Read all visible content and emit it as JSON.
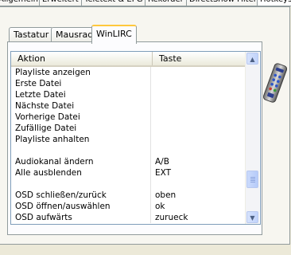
{
  "top_tabs": [
    "Allgemein",
    "Erweitert",
    "Teletext & EPG",
    "Rekorder",
    "DirectShow Filter",
    "Hotkeys"
  ],
  "tabs": [
    {
      "label": "Tastatur"
    },
    {
      "label": "Mausrad"
    },
    {
      "label": "WinLIRC"
    }
  ],
  "active_tab": "WinLIRC",
  "table": {
    "columns": [
      "Aktion",
      "Taste"
    ],
    "rows": [
      {
        "action": "Playliste anzeigen",
        "key": ""
      },
      {
        "action": "Erste Datei",
        "key": ""
      },
      {
        "action": "Letzte Datei",
        "key": ""
      },
      {
        "action": "Nächste Datei",
        "key": ""
      },
      {
        "action": "Vorherige Datei",
        "key": ""
      },
      {
        "action": "Zufällige Datei",
        "key": ""
      },
      {
        "action": "Playliste anhalten",
        "key": ""
      },
      {
        "action": "",
        "key": ""
      },
      {
        "action": "Audiokanal ändern",
        "key": "A/B"
      },
      {
        "action": "Alle ausblenden",
        "key": "EXT"
      },
      {
        "action": "",
        "key": ""
      },
      {
        "action": "OSD schließen/zurück",
        "key": "oben"
      },
      {
        "action": "OSD öffnen/auswählen",
        "key": "ok"
      },
      {
        "action": "OSD aufwärts",
        "key": "zurueck"
      }
    ]
  },
  "scrollbar": {
    "position_fraction": 0.88
  },
  "icons": {
    "remote": "remote-control-icon",
    "scroll_up": "arrow-up-icon",
    "scroll_down": "arrow-down-icon"
  }
}
